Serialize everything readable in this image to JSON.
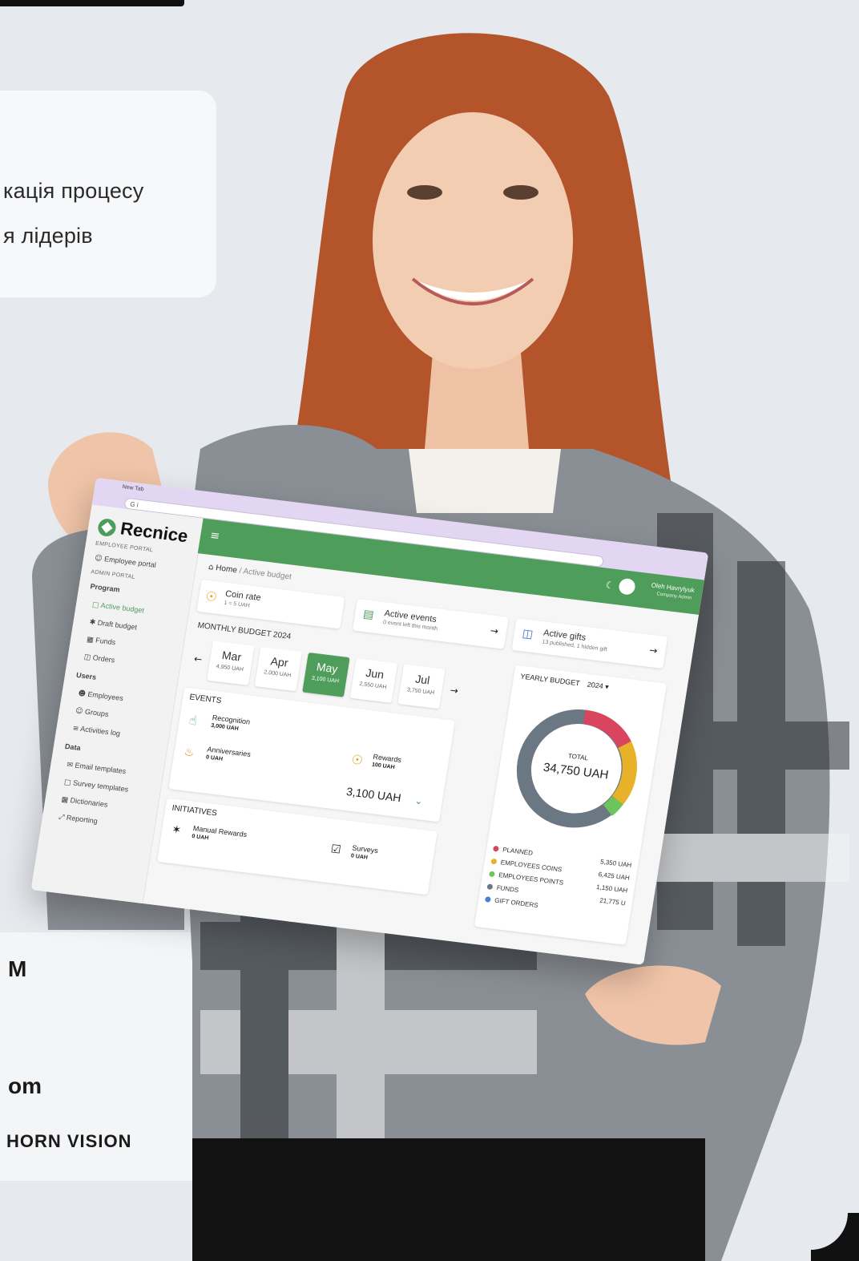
{
  "info_card": {
    "line1": "кація процесу",
    "line2": "я лідерів"
  },
  "contact_panel": {
    "line1": "M",
    "line2": "om",
    "line3": "HORN VISION"
  },
  "tablet": {
    "browser": {
      "tab_label": "New Tab",
      "url": "G i"
    },
    "sidebar": {
      "logo": "Recnice",
      "employee_portal_header": "EMPLOYEE PORTAL",
      "employee_portal_item": "Employee portal",
      "admin_portal_header": "ADMIN PORTAL",
      "program_header": "Program",
      "items_program": [
        "Active budget",
        "Draft budget",
        "Funds",
        "Orders"
      ],
      "users_header": "Users",
      "items_users": [
        "Employees",
        "Groups",
        "Activities log"
      ],
      "data_header": "Data",
      "items_data": [
        "Email templates",
        "Survey templates",
        "Dictionaries",
        "Reporting"
      ]
    },
    "topbar": {
      "user_name": "Oleh Havrylyuk",
      "user_role": "Company Admin"
    },
    "breadcrumb": {
      "home": "Home",
      "separator": "/",
      "current": "Active budget"
    },
    "coin_rate": {
      "title": "Coin rate",
      "sub": "1 = 5 UAH"
    },
    "active_events": {
      "title": "Active events",
      "sub": "0 event left this month"
    },
    "active_gifts": {
      "title": "Active gifts",
      "sub": "13 published, 1 hidden gift"
    },
    "monthly_budget": {
      "title": "MONTHLY BUDGET 2024",
      "months": [
        {
          "name": "Mar",
          "value": "4,950 UAH"
        },
        {
          "name": "Apr",
          "value": "2,000 UAH"
        },
        {
          "name": "May",
          "value": "3,100 UAH"
        },
        {
          "name": "Jun",
          "value": "2,550 UAH"
        },
        {
          "name": "Jul",
          "value": "3,750 UAH"
        }
      ]
    },
    "events": {
      "title": "EVENTS",
      "recognition_label": "Recognition",
      "recognition_value": "3,000 UAH",
      "anniversaries_label": "Anniversaries",
      "anniversaries_value": "0 UAH",
      "rewards_label": "Rewards",
      "rewards_value": "100 UAH",
      "total": "3,100 UAH"
    },
    "initiatives": {
      "title": "INITIATIVES",
      "manual_label": "Manual Rewards",
      "manual_value": "0 UAH",
      "surveys_label": "Surveys",
      "surveys_value": "0 UAH"
    },
    "yearly_budget": {
      "title": "YEARLY BUDGET",
      "year": "2024",
      "total_label": "TOTAL",
      "total_value": "34,750 UAH",
      "legend": [
        {
          "label": "PLANNED",
          "value": "5,350 UAH",
          "color": "#d9455f"
        },
        {
          "label": "EMPLOYEES COINS",
          "value": "6,425 UAH",
          "color": "#e7b12a"
        },
        {
          "label": "EMPLOYEES POINTS",
          "value": "1,150 UAH",
          "color": "#6cc45a"
        },
        {
          "label": "FUNDS",
          "value": "21,775 U",
          "color": "#6c7784"
        },
        {
          "label": "GIFT ORDERS",
          "value": "",
          "color": "#4c7fd8"
        }
      ]
    }
  },
  "colors": {
    "brand_green": "#4f9d5b",
    "browser_purple": "#e2d6f3",
    "page_bg": "#e6e9ee"
  }
}
